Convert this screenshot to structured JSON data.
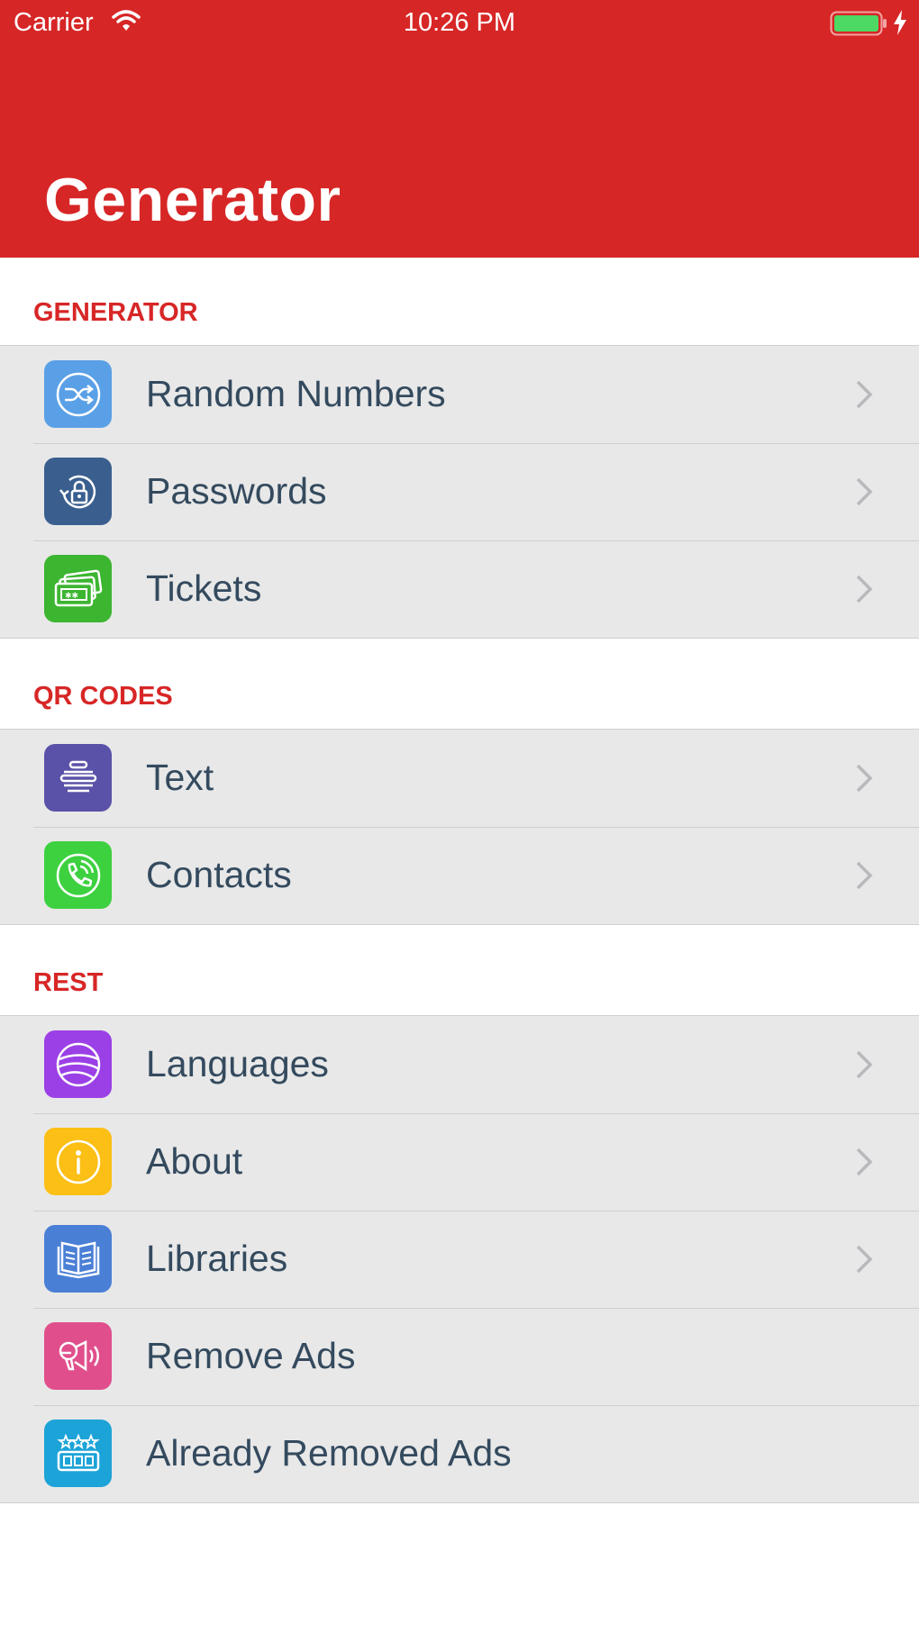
{
  "status_bar": {
    "carrier": "Carrier",
    "time": "10:26 PM",
    "battery_color": "#4cd964"
  },
  "nav": {
    "title": "Generator",
    "bar_color": "#d72626"
  },
  "sections": [
    {
      "header": "GENERATOR",
      "items": [
        {
          "label": "Random Numbers",
          "icon": "shuffle-icon",
          "color": "#5aa0e6",
          "chevron": true
        },
        {
          "label": "Passwords",
          "icon": "lock-rotate-icon",
          "color": "#3a5f8f",
          "chevron": true
        },
        {
          "label": "Tickets",
          "icon": "tickets-icon",
          "color": "#3cb531",
          "chevron": true
        }
      ]
    },
    {
      "header": "QR CODES",
      "items": [
        {
          "label": "Text",
          "icon": "text-lines-icon",
          "color": "#5a52a8",
          "chevron": true
        },
        {
          "label": "Contacts",
          "icon": "phone-icon",
          "color": "#3dd13f",
          "chevron": true
        }
      ]
    },
    {
      "header": "REST",
      "items": [
        {
          "label": "Languages",
          "icon": "globe-icon",
          "color": "#9b3fe6",
          "chevron": true
        },
        {
          "label": "About",
          "icon": "info-icon",
          "color": "#fbbf15",
          "chevron": true
        },
        {
          "label": "Libraries",
          "icon": "book-icon",
          "color": "#4a7fd6",
          "chevron": true
        },
        {
          "label": "Remove Ads",
          "icon": "megaphone-icon",
          "color": "#e04f8c",
          "chevron": false
        },
        {
          "label": "Already Removed Ads",
          "icon": "rating-stars-icon",
          "color": "#1ca3d8",
          "chevron": false
        }
      ]
    }
  ]
}
